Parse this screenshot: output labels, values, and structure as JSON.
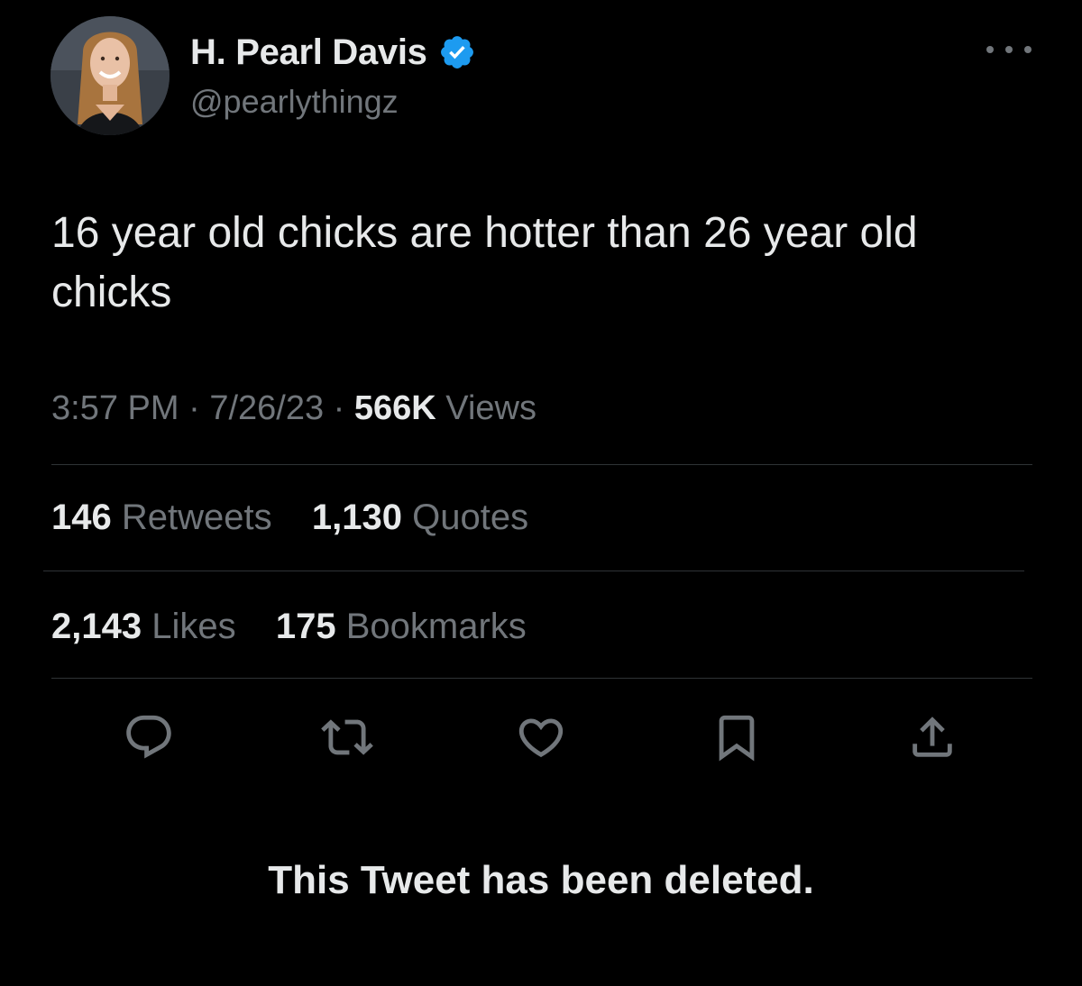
{
  "author": {
    "display_name": "H. Pearl Davis",
    "handle": "@pearlythingz",
    "verified_color": "#1d9bf0"
  },
  "tweet": {
    "text": "16 year old chicks are hotter than 26 year old chicks",
    "time": "3:57 PM",
    "separator": "·",
    "date": "7/26/23",
    "views_count": "566K",
    "views_label": "Views"
  },
  "stats": {
    "retweets_count": "146",
    "retweets_label": "Retweets",
    "quotes_count": "1,130",
    "quotes_label": "Quotes",
    "likes_count": "2,143",
    "likes_label": "Likes",
    "bookmarks_count": "175",
    "bookmarks_label": "Bookmarks"
  },
  "actions": {
    "icons": [
      "reply-icon",
      "retweet-icon",
      "like-icon",
      "bookmark-icon",
      "share-icon"
    ],
    "icon_color": "#71767b"
  },
  "status": {
    "message": "This Tweet has been deleted."
  },
  "colors": {
    "background": "#000000",
    "text_primary": "#e7e9ea",
    "text_secondary": "#71767b",
    "divider": "#2f3336"
  }
}
